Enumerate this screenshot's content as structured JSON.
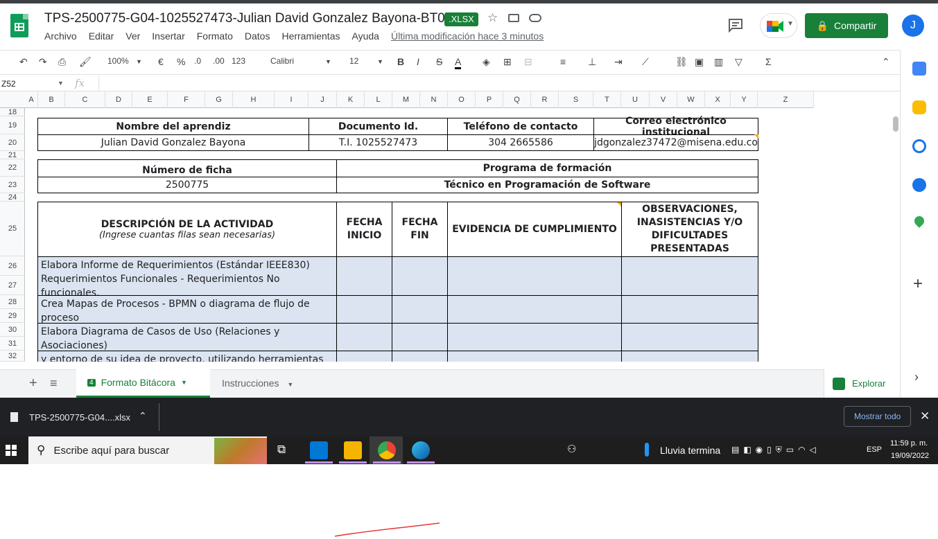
{
  "doc": {
    "title": "TPS-2500775-G04-1025527473-Julian David Gonzalez Bayona-BT02",
    "badge": ".XLSX",
    "last_modified": "Última modificación hace 3 minutos",
    "share_label": "Compartir",
    "avatar_initial": "J"
  },
  "menu": [
    "Archivo",
    "Editar",
    "Ver",
    "Insertar",
    "Formato",
    "Datos",
    "Herramientas",
    "Ayuda"
  ],
  "toolbar": {
    "zoom": "100%",
    "currency": "€",
    "percent": "%",
    "dec_less": ".0",
    "dec_more": ".00",
    "format_more": "123",
    "font": "Calibri",
    "font_size": "12",
    "bold": "B",
    "italic": "I",
    "strike": "S",
    "text_color": "A"
  },
  "namebox": "Z52",
  "fx": "fx",
  "columns": [
    "A",
    "B",
    "C",
    "D",
    "E",
    "F",
    "G",
    "H",
    "I",
    "J",
    "K",
    "L",
    "M",
    "N",
    "O",
    "P",
    "Q",
    "R",
    "S",
    "T",
    "U",
    "V",
    "W",
    "X",
    "Y",
    "Z"
  ],
  "rows": [
    "18",
    "19",
    "20",
    "21",
    "22",
    "23",
    "24",
    "25",
    "26",
    "27",
    "28",
    "29",
    "30",
    "31",
    "32"
  ],
  "sheet": {
    "h_nombre": "Nombre del aprendiz",
    "h_documento": "Documento Id.",
    "h_telefono": "Teléfono de contacto",
    "h_correo": "Correo electrónico institucional",
    "v_nombre": "Julian David Gonzalez Bayona",
    "v_documento": "T.I. 1025527473",
    "v_telefono": "304 2665586",
    "v_correo": "jdgonzalez37472@misena.edu.co",
    "h_ficha": "Número de ficha",
    "h_programa": "Programa de formación",
    "v_ficha": "2500775",
    "v_programa": "Técnico en Programación de Software",
    "h_desc": "DESCRIPCIÓN DE LA ACTIVIDAD",
    "h_desc_sub": "(Ingrese cuantas filas sean necesarias)",
    "h_fecha_inicio_1": "FECHA",
    "h_fecha_inicio_2": "INICIO",
    "h_fecha_fin_1": "FECHA",
    "h_fecha_fin_2": "FIN",
    "h_evidencia": "EVIDENCIA DE CUMPLIMIENTO",
    "h_obs_1": "OBSERVACIONES,",
    "h_obs_2": "INASISTENCIAS  Y/O",
    "h_obs_3": "DIFICULTADES",
    "h_obs_4": "PRESENTADAS",
    "activities": [
      "Elabora Informe de Requerimientos (Estándar IEEE830) Requerimientos   Funcionales - Requerimientos No funcionales.",
      "Crea Mapas de Procesos - BPMN o diagrama de flujo de proceso",
      "Elabora Diagrama de Casos de Uso (Relaciones y Asociaciones)",
      "y entorno de su idea de proyecto, utilizando herramientas"
    ]
  },
  "tabs": {
    "active_badge": "4",
    "active": "Formato Bitácora",
    "other": "Instrucciones",
    "explore": "Explorar"
  },
  "download": {
    "file": "TPS-2500775-G04....xlsx",
    "show_all": "Mostrar todo"
  },
  "taskbar": {
    "search_placeholder": "Escribe aquí para buscar",
    "weather": "Lluvia termina",
    "lang": "ESP",
    "time": "11:59 p. m.",
    "date": "19/09/2022"
  }
}
